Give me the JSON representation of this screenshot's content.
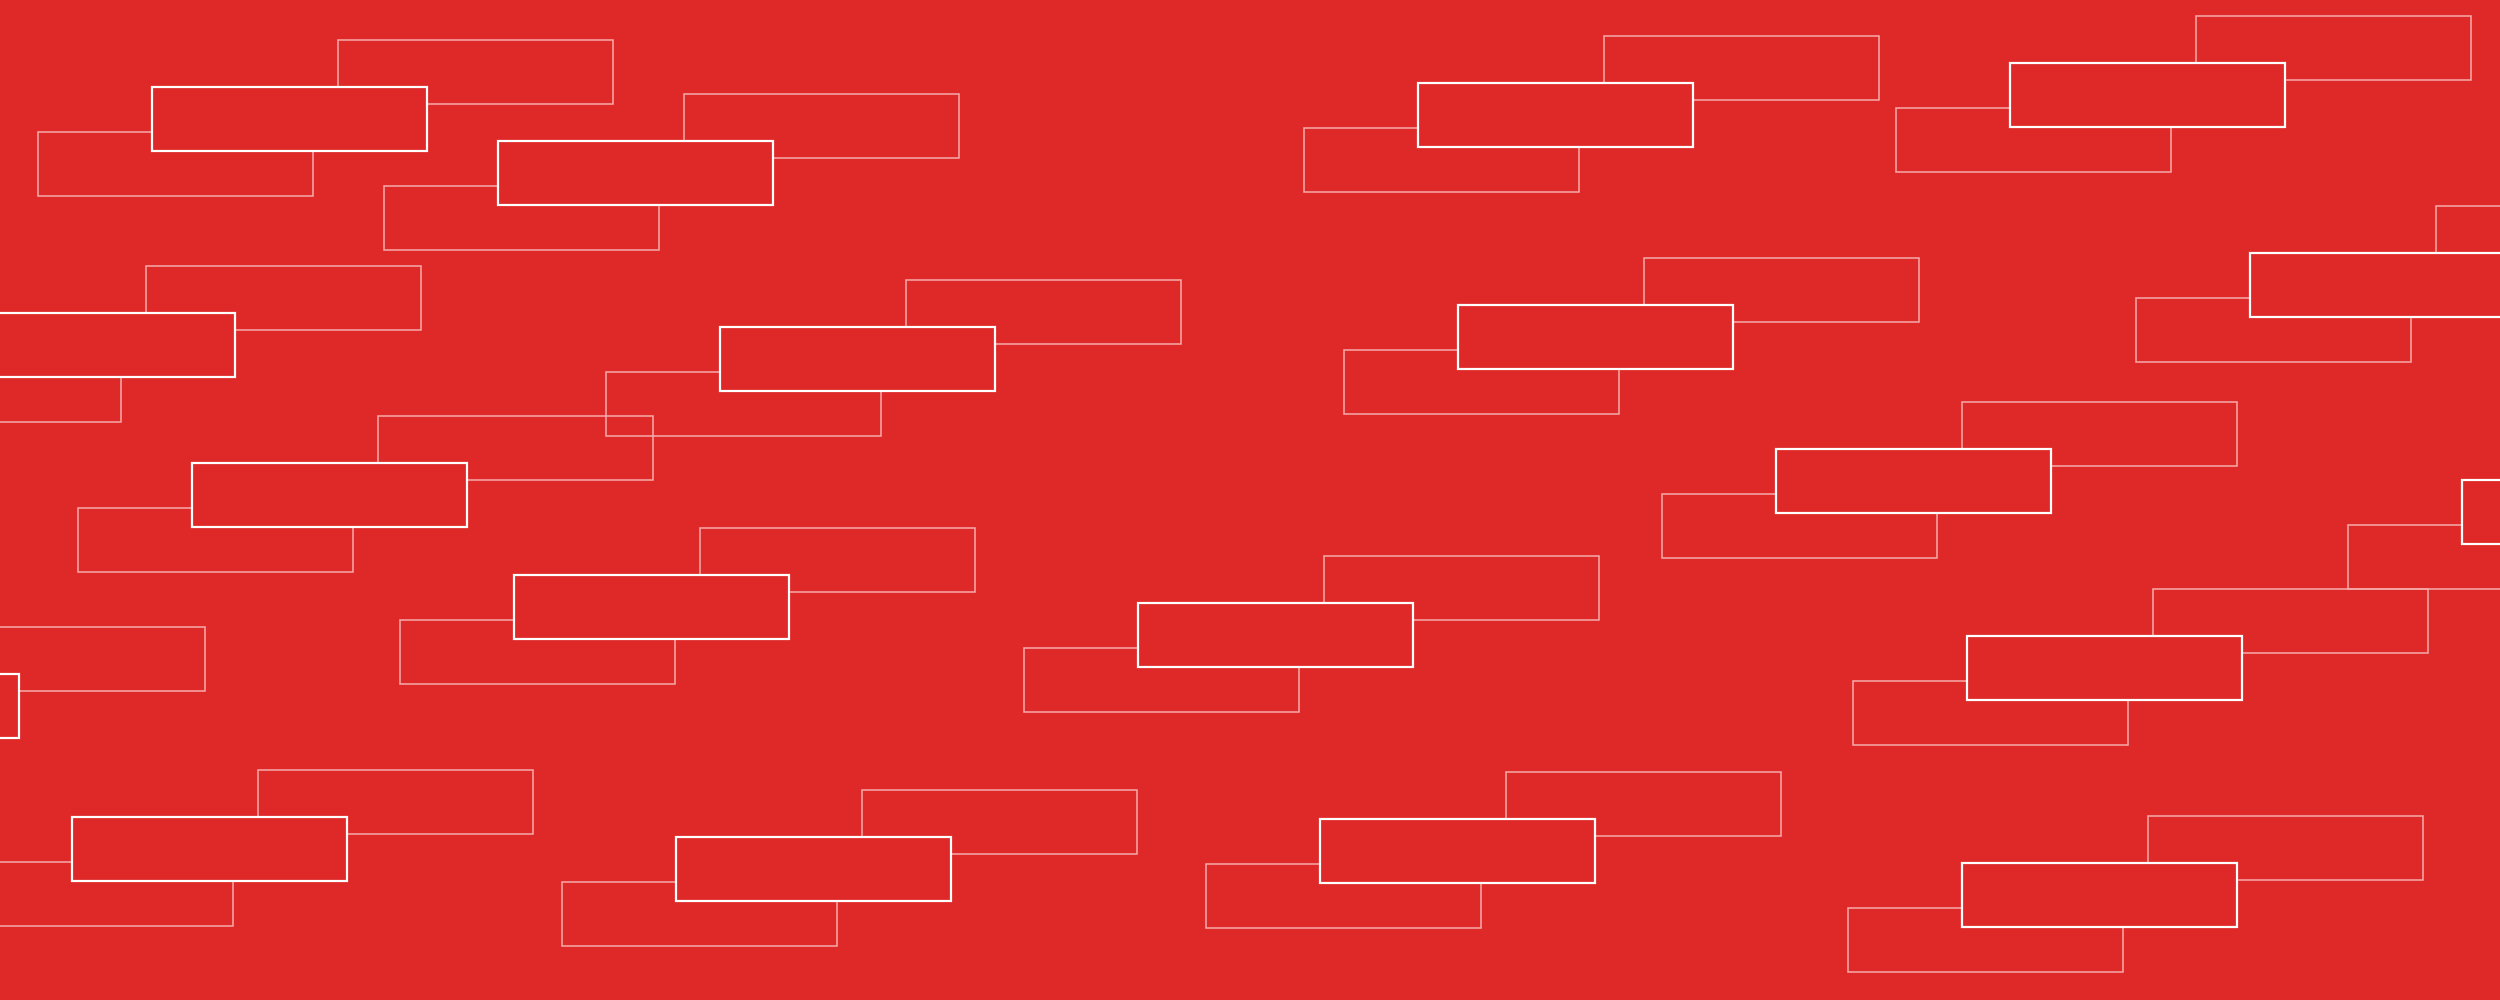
{
  "background": {
    "color": "#DF2929",
    "motif": "stacked-outlined-rectangles",
    "front_outline_color": "#FFFFFF",
    "back_outline_color": "#F6B3B3"
  }
}
